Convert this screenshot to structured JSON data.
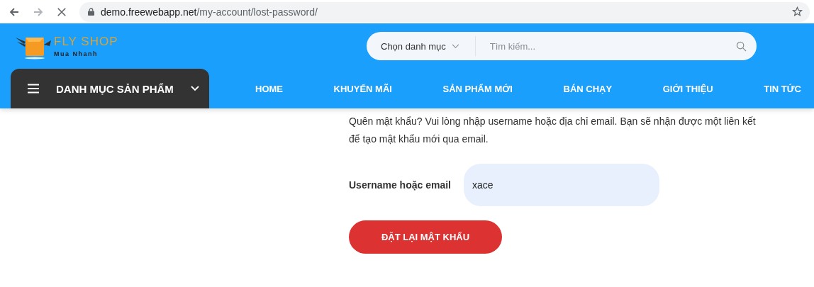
{
  "browser": {
    "url_host": "demo.freewebapp.net",
    "url_path": "/my-account/lost-password/"
  },
  "logo": {
    "name": "FLY SHOP",
    "tagline": "Mua Nhanh"
  },
  "search": {
    "category": "Chọn danh mục",
    "placeholder": "Tìm kiếm..."
  },
  "category_menu": {
    "label": "DANH MỤC SẢN PHẨM"
  },
  "nav": [
    {
      "label": "HOME"
    },
    {
      "label": "KHUYẾN MÃI"
    },
    {
      "label": "SẢN PHẨM MỚI"
    },
    {
      "label": "BÁN CHẠY"
    },
    {
      "label": "GIỚI THIỆU"
    },
    {
      "label": "TIN TỨC"
    }
  ],
  "form": {
    "intro": "Quên mật khẩu? Vui lòng nhập username hoặc địa chỉ email. Bạn sẽ nhận được một liên kết để tạo mật khẩu mới qua email.",
    "field_label": "Username hoặc email",
    "field_value": "xace",
    "submit": "ĐẶT LẠI MẬT KHẨU"
  }
}
